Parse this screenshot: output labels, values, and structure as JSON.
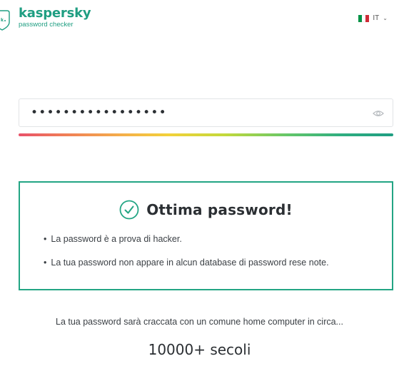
{
  "header": {
    "brand": "kaspersky",
    "subtitle": "password checker",
    "language_code": "IT",
    "brand_color": "#1f9e82",
    "flag_colors": [
      "#009246",
      "#ffffff",
      "#ce2b37"
    ],
    "icons": {
      "logo": "kaspersky-logo-icon",
      "chevron": "chevron-down-icon"
    }
  },
  "password_field": {
    "masked_value": "•••••••••••••••••",
    "eye_icon": "eye-icon"
  },
  "strength_meter": {
    "level": 1.0,
    "colors": [
      "#e8526a",
      "#f4b04a",
      "#f3d13a",
      "#63c66a",
      "#1f9e82"
    ]
  },
  "result": {
    "title": "Ottima password!",
    "check_icon": "check-circle-icon",
    "accent_color": "#23a584",
    "bullets": [
      "La password è a prova di hacker.",
      "La tua password non appare in alcun database di password rese note."
    ]
  },
  "crack_time": {
    "description": "La tua password sarà craccata con un comune home computer in circa...",
    "value": "10000+ secoli"
  }
}
